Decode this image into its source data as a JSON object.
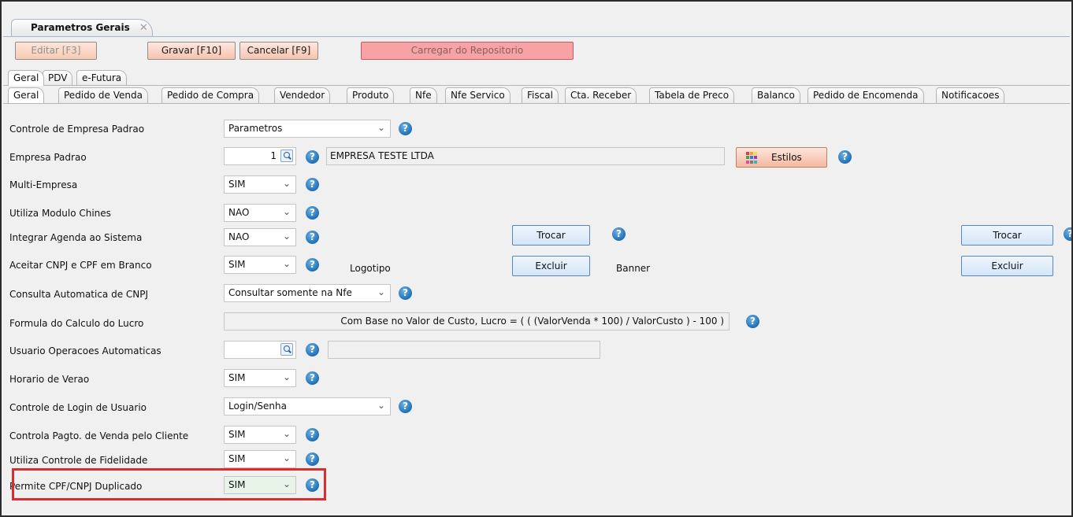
{
  "window": {
    "tab_title": "Parametros Gerais",
    "tab_close": "✕"
  },
  "toolbar": {
    "edit": "Editar [F3]",
    "save": "Gravar [F10]",
    "cancel": "Cancelar [F9]",
    "load_repo": "Carregar do Repositorio"
  },
  "tabs_top": [
    "Geral",
    "PDV",
    "e-Futura"
  ],
  "tabs_second": [
    "Geral",
    "Pedido de Venda",
    "Pedido de Compra",
    "Vendedor",
    "Produto",
    "Nfe",
    "Nfe Servico",
    "Fiscal",
    "Cta. Receber",
    "Tabela de Preco",
    "Balanco",
    "Pedido de Encomenda",
    "Notificacoes"
  ],
  "rows": {
    "controle_empresa": {
      "label": "Controle de Empresa Padrao",
      "value": "Parametros"
    },
    "empresa_padrao": {
      "label": "Empresa Padrao",
      "value": "1",
      "name": "EMPRESA TESTE LTDA"
    },
    "multi_empresa": {
      "label": "Multi-Empresa",
      "value": "SIM"
    },
    "modulo_chines": {
      "label": "Utiliza Modulo Chines",
      "value": "NAO"
    },
    "agenda": {
      "label": "Integrar Agenda ao Sistema",
      "value": "NAO"
    },
    "cnpj_branco": {
      "label": "Aceitar CNPJ e CPF em Branco",
      "value": "SIM"
    },
    "consulta_cnpj": {
      "label": "Consulta Automatica de CNPJ",
      "value": "Consultar somente na Nfe"
    },
    "formula_lucro": {
      "label": "Formula do Calculo do Lucro",
      "value": "Com Base no Valor de Custo, Lucro = ( ( (ValorVenda * 100) / ValorCusto ) - 100 )"
    },
    "usuario_auto": {
      "label": "Usuario Operacoes Automaticas",
      "value": ""
    },
    "horario_verao": {
      "label": "Horario de Verao",
      "value": "SIM"
    },
    "login": {
      "label": "Controle de Login de Usuario",
      "value": "Login/Senha"
    },
    "pagto_cliente": {
      "label": "Controla Pagto. de Venda pelo Cliente",
      "value": "SIM"
    },
    "fidelidade": {
      "label": "Utiliza Controle de Fidelidade",
      "value": "SIM"
    },
    "cpf_duplicado": {
      "label": "Permite CPF/CNPJ Duplicado",
      "value": "SIM"
    }
  },
  "buttons": {
    "estilos": "Estilos",
    "trocar": "Trocar",
    "excluir": "Excluir"
  },
  "images": {
    "logo_label": "Logotipo",
    "banner_label": "Banner"
  },
  "help_glyph": "?",
  "dropdown_glyph": "⌄",
  "colors": {
    "highlight": "#e12b2b",
    "help_icon": "#1f6fb5",
    "danger_button": "#f7a2a4"
  }
}
